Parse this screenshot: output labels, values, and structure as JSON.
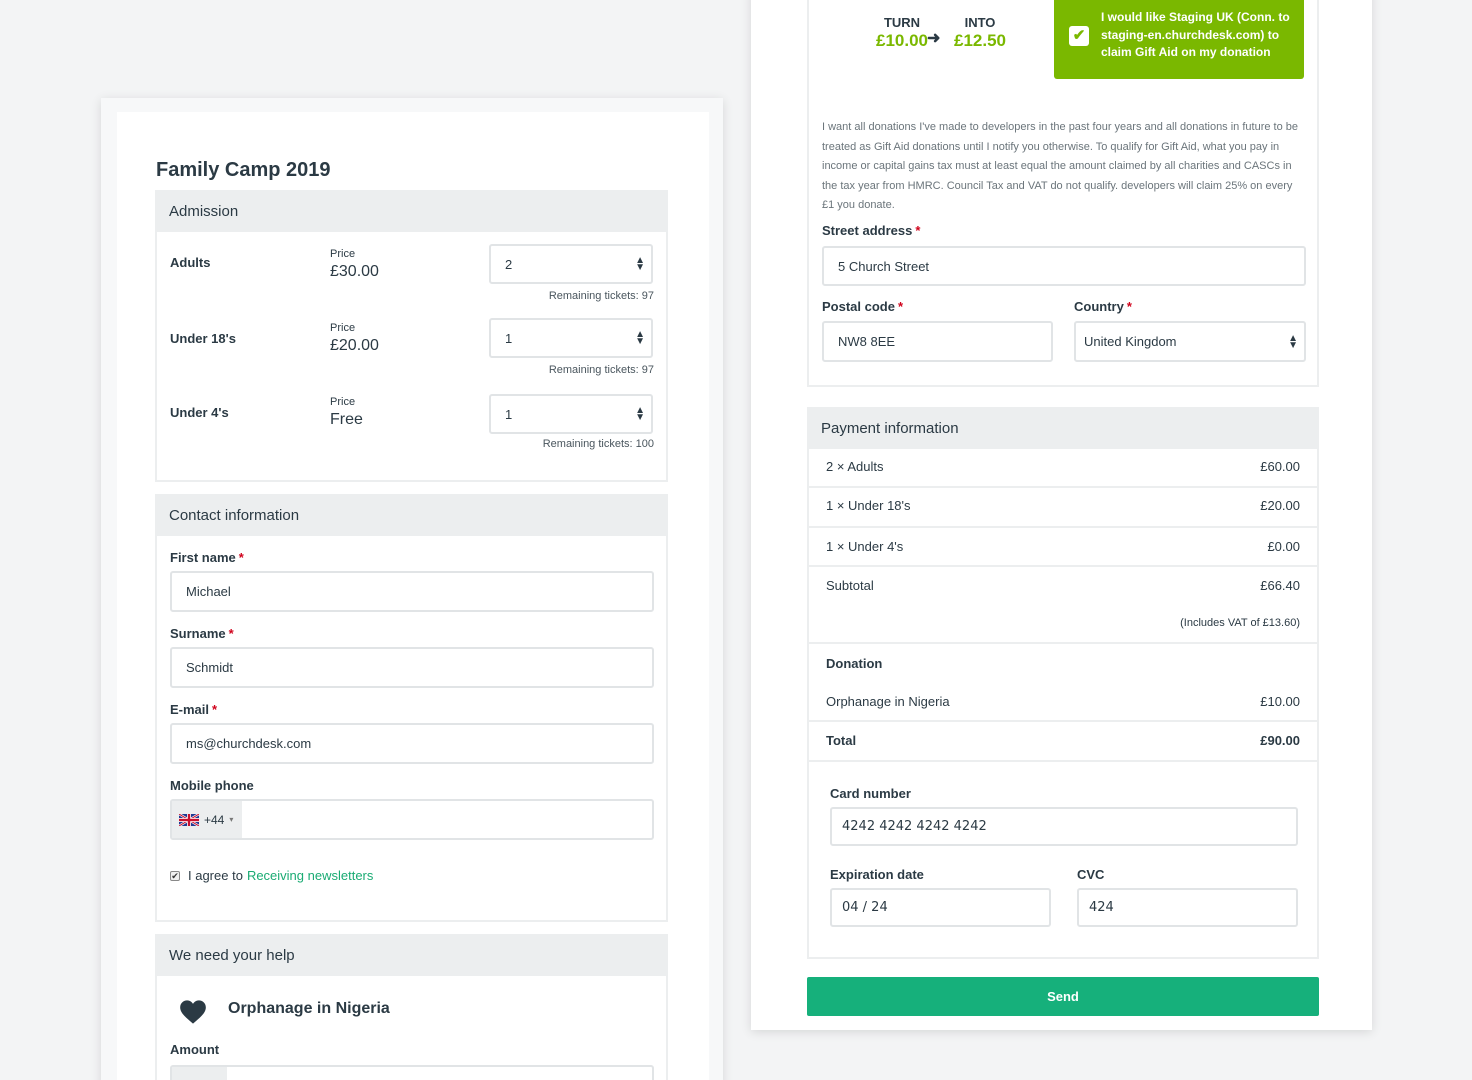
{
  "event": {
    "title": "Family Camp 2019"
  },
  "admission": {
    "heading": "Admission",
    "price_label": "Price",
    "tickets": [
      {
        "name": "Adults",
        "price": "£30.00",
        "qty": "2",
        "remaining": "Remaining tickets: 97"
      },
      {
        "name": "Under 18's",
        "price": "£20.00",
        "qty": "1",
        "remaining": "Remaining tickets: 97"
      },
      {
        "name": "Under 4's",
        "price": "Free",
        "qty": "1",
        "remaining": "Remaining tickets: 100"
      }
    ]
  },
  "contact": {
    "heading": "Contact information",
    "first_name_label": "First name",
    "first_name_value": "Michael",
    "surname_label": "Surname",
    "surname_value": "Schmidt",
    "email_label": "E-mail",
    "email_value": "ms@churchdesk.com",
    "phone_label": "Mobile phone",
    "phone_prefix": "+44",
    "required_mark": "*",
    "newsletter_text": "I agree to",
    "newsletter_link": "Receiving newsletters"
  },
  "help": {
    "heading": "We need your help",
    "cause": "Orphanage in Nigeria",
    "amount_label": "Amount"
  },
  "gift_aid": {
    "turn_label": "TURN",
    "turn_value": "£10.00",
    "into_label": "INTO",
    "into_value": "£12.50",
    "checkbox_text": "I would like Staging UK (Conn. to staging-en.churchdesk.com) to claim Gift Aid on my donation",
    "declaration": "I want all donations I've made to developers in the past four years and all donations in future to be treated as Gift Aid donations until I notify you otherwise. To qualify for Gift Aid, what you pay in income or capital gains tax must at least equal the amount claimed by all charities and CASCs in the tax year from HMRC. Council Tax and VAT do not qualify. developers will claim 25% on every £1 you donate.",
    "accent_color": "#7ab800"
  },
  "address": {
    "street_label": "Street address",
    "street_value": "5 Church Street",
    "postal_label": "Postal code",
    "postal_value": "NW8 8EE",
    "country_label": "Country",
    "country_value": "United Kingdom"
  },
  "payment": {
    "heading": "Payment information",
    "lines": [
      {
        "label": "2 × Adults",
        "amount": "£60.00"
      },
      {
        "label": "1 × Under 18's",
        "amount": "£20.00"
      },
      {
        "label": "1 × Under 4's",
        "amount": "£0.00"
      }
    ],
    "subtotal_label": "Subtotal",
    "subtotal_value": "£66.40",
    "vat_note": "(Includes VAT of £13.60)",
    "donation_label": "Donation",
    "donation_cause": "Orphanage in Nigeria",
    "donation_amount": "£10.00",
    "total_label": "Total",
    "total_value": "£90.00",
    "card_label": "Card number",
    "card_value": "4242 4242 4242 4242",
    "expiry_label": "Expiration date",
    "expiry_value": "04 / 24",
    "cvc_label": "CVC",
    "cvc_value": "424",
    "send_label": "Send",
    "send_color": "#16b07b"
  }
}
